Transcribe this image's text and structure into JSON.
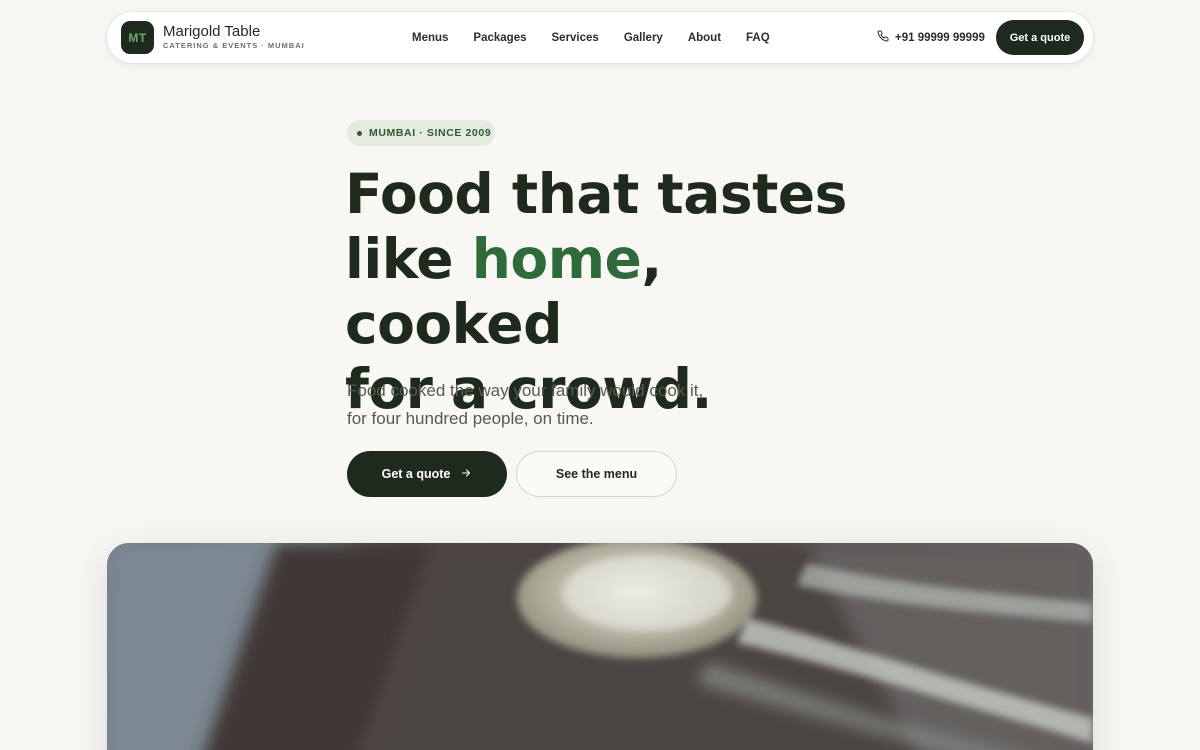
{
  "brand": {
    "initials": "MT",
    "name": "Marigold Table",
    "tagline": "CATERING & EVENTS · MUMBAI"
  },
  "nav": {
    "links": [
      "Menus",
      "Packages",
      "Services",
      "Gallery",
      "About",
      "FAQ"
    ],
    "phone": "+91 99999 99999",
    "cta": "Get a quote"
  },
  "hero": {
    "pill": "MUMBAI · SINCE 2009",
    "headline": {
      "line1": "Food that tastes",
      "line2_pre": "like ",
      "line2_accent": "home",
      "line2_post": ", cooked",
      "line3": "for a crowd."
    },
    "lede": "Food cooked the way your family would cook it, for four hundred people, on time.",
    "primary_cta": "Get a quote",
    "secondary_cta": "See the menu"
  },
  "colors": {
    "background": "#f8f7f3",
    "dark": "#1f2a1f",
    "accent": "#2f6a3a",
    "pill_bg": "#e3ebdf"
  },
  "icons": {
    "phone": "phone-icon",
    "arrow": "arrow-right-icon"
  }
}
